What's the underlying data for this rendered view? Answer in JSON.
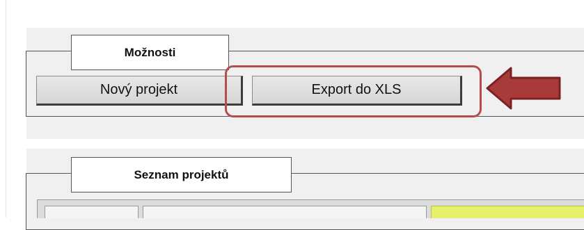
{
  "options_group": {
    "title": "Možnosti",
    "new_project_label": "Nový projekt",
    "export_label": "Export do XLS"
  },
  "projects_group": {
    "title": "Seznam projektů"
  },
  "annotation": {
    "highlight_color": "#b74c4c",
    "arrow_color": "#a83a3a",
    "arrow_icon": "arrow-left"
  },
  "table": {
    "highlight_cell_color": "#e6f06a"
  }
}
